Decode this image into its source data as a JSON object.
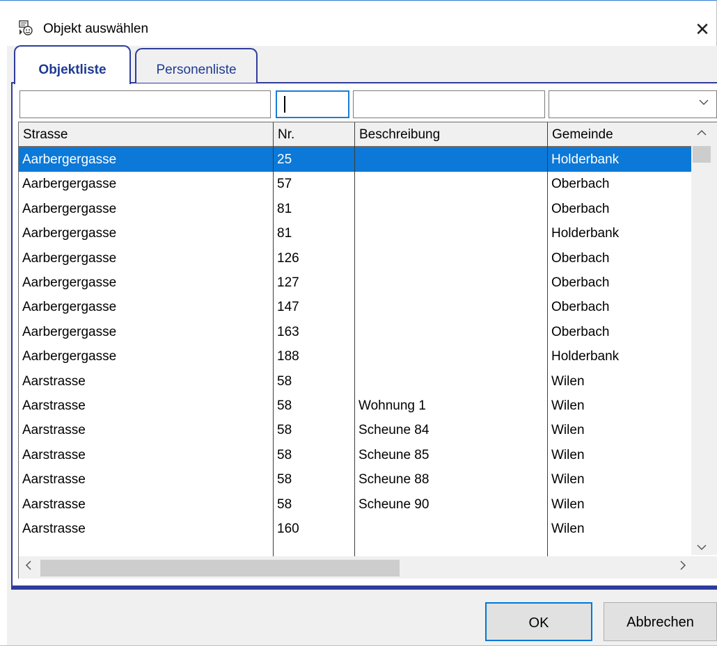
{
  "window": {
    "title": "Objekt auswählen",
    "close_glyph": "✕",
    "title_icon": "app-icon"
  },
  "tabs": [
    {
      "label": "Objektliste",
      "active": true
    },
    {
      "label": "Personenliste",
      "active": false
    }
  ],
  "filters": {
    "strasse": "",
    "nr": "",
    "beschreibung": "",
    "gemeinde": ""
  },
  "table": {
    "columns": [
      "Strasse",
      "Nr.",
      "Beschreibung",
      "Gemeinde"
    ],
    "rows": [
      {
        "strasse": "Aarbergergasse",
        "nr": "25",
        "beschreibung": "",
        "gemeinde": "Holderbank",
        "selected": true
      },
      {
        "strasse": "Aarbergergasse",
        "nr": "57",
        "beschreibung": "",
        "gemeinde": "Oberbach"
      },
      {
        "strasse": "Aarbergergasse",
        "nr": "81",
        "beschreibung": "",
        "gemeinde": "Oberbach"
      },
      {
        "strasse": "Aarbergergasse",
        "nr": "81",
        "beschreibung": "",
        "gemeinde": "Holderbank"
      },
      {
        "strasse": "Aarbergergasse",
        "nr": "126",
        "beschreibung": "",
        "gemeinde": "Oberbach"
      },
      {
        "strasse": "Aarbergergasse",
        "nr": "127",
        "beschreibung": "",
        "gemeinde": "Oberbach"
      },
      {
        "strasse": "Aarbergergasse",
        "nr": "147",
        "beschreibung": "",
        "gemeinde": "Oberbach"
      },
      {
        "strasse": "Aarbergergasse",
        "nr": "163",
        "beschreibung": "",
        "gemeinde": "Oberbach"
      },
      {
        "strasse": "Aarbergergasse",
        "nr": "188",
        "beschreibung": "",
        "gemeinde": "Holderbank"
      },
      {
        "strasse": "Aarstrasse",
        "nr": "58",
        "beschreibung": "",
        "gemeinde": "Wilen"
      },
      {
        "strasse": "Aarstrasse",
        "nr": "58",
        "beschreibung": "Wohnung 1",
        "gemeinde": "Wilen"
      },
      {
        "strasse": "Aarstrasse",
        "nr": "58",
        "beschreibung": "Scheune 84",
        "gemeinde": "Wilen"
      },
      {
        "strasse": "Aarstrasse",
        "nr": "58",
        "beschreibung": "Scheune 85",
        "gemeinde": "Wilen"
      },
      {
        "strasse": "Aarstrasse",
        "nr": "58",
        "beschreibung": "Scheune 88",
        "gemeinde": "Wilen"
      },
      {
        "strasse": "Aarstrasse",
        "nr": "58",
        "beschreibung": "Scheune 90",
        "gemeinde": "Wilen"
      },
      {
        "strasse": "Aarstrasse",
        "nr": "160",
        "beschreibung": "",
        "gemeinde": "Wilen"
      }
    ]
  },
  "scroll": {
    "up": "⌃",
    "down": "⌄",
    "left": "<",
    "right": ">"
  },
  "buttons": {
    "ok": "OK",
    "cancel": "Abbrechen"
  },
  "colors": {
    "selection": "#0c78d7",
    "tab_border": "#2e3c9b",
    "tab_text": "#1f3a93",
    "focus": "#0078d7"
  }
}
